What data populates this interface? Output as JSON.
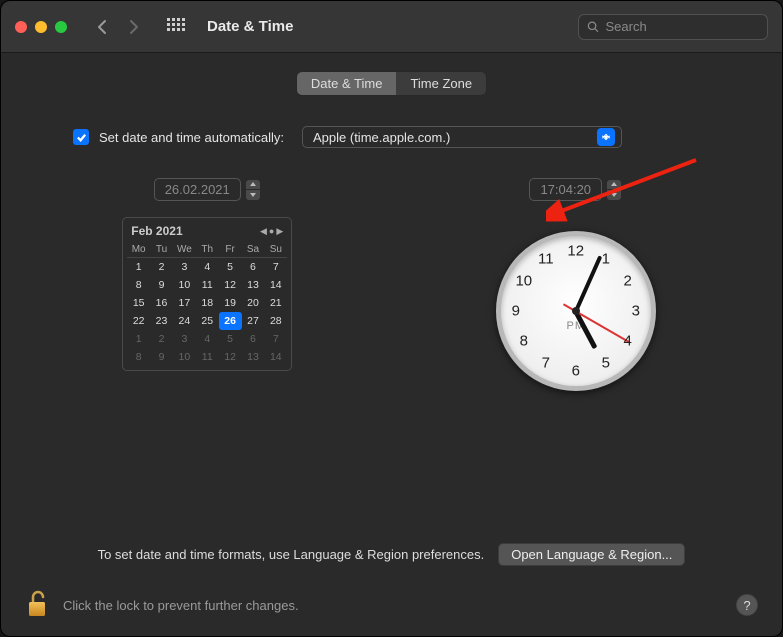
{
  "window": {
    "title": "Date & Time"
  },
  "search": {
    "placeholder": "Search"
  },
  "tabs": {
    "dateTime": "Date & Time",
    "timeZone": "Time Zone",
    "active": "dateTime"
  },
  "auto": {
    "label": "Set date and time automatically:",
    "checked": true,
    "server": "Apple (time.apple.com.)"
  },
  "dateField": "26.02.2021",
  "timeField": "17:04:20",
  "calendar": {
    "title": "Feb 2021",
    "dow": [
      "Mo",
      "Tu",
      "We",
      "Th",
      "Fr",
      "Sa",
      "Su"
    ],
    "leading": [],
    "days": [
      1,
      2,
      3,
      4,
      5,
      6,
      7,
      8,
      9,
      10,
      11,
      12,
      13,
      14,
      15,
      16,
      17,
      18,
      19,
      20,
      21,
      22,
      23,
      24,
      25,
      26,
      27,
      28
    ],
    "trailing": [
      1,
      2,
      3,
      4,
      5,
      6,
      7,
      8,
      9,
      10,
      11,
      12,
      13,
      14
    ],
    "today": 26
  },
  "clock": {
    "numbers": [
      "12",
      "1",
      "2",
      "3",
      "4",
      "5",
      "6",
      "7",
      "8",
      "9",
      "10",
      "11"
    ],
    "ampm": "PM",
    "hourAngle": 152,
    "minuteAngle": 24,
    "secondAngle": 120
  },
  "prefRow": {
    "text": "To set date and time formats, use Language & Region preferences.",
    "button": "Open Language & Region..."
  },
  "lock": {
    "text": "Click the lock to prevent further changes."
  },
  "help": {
    "label": "?"
  }
}
